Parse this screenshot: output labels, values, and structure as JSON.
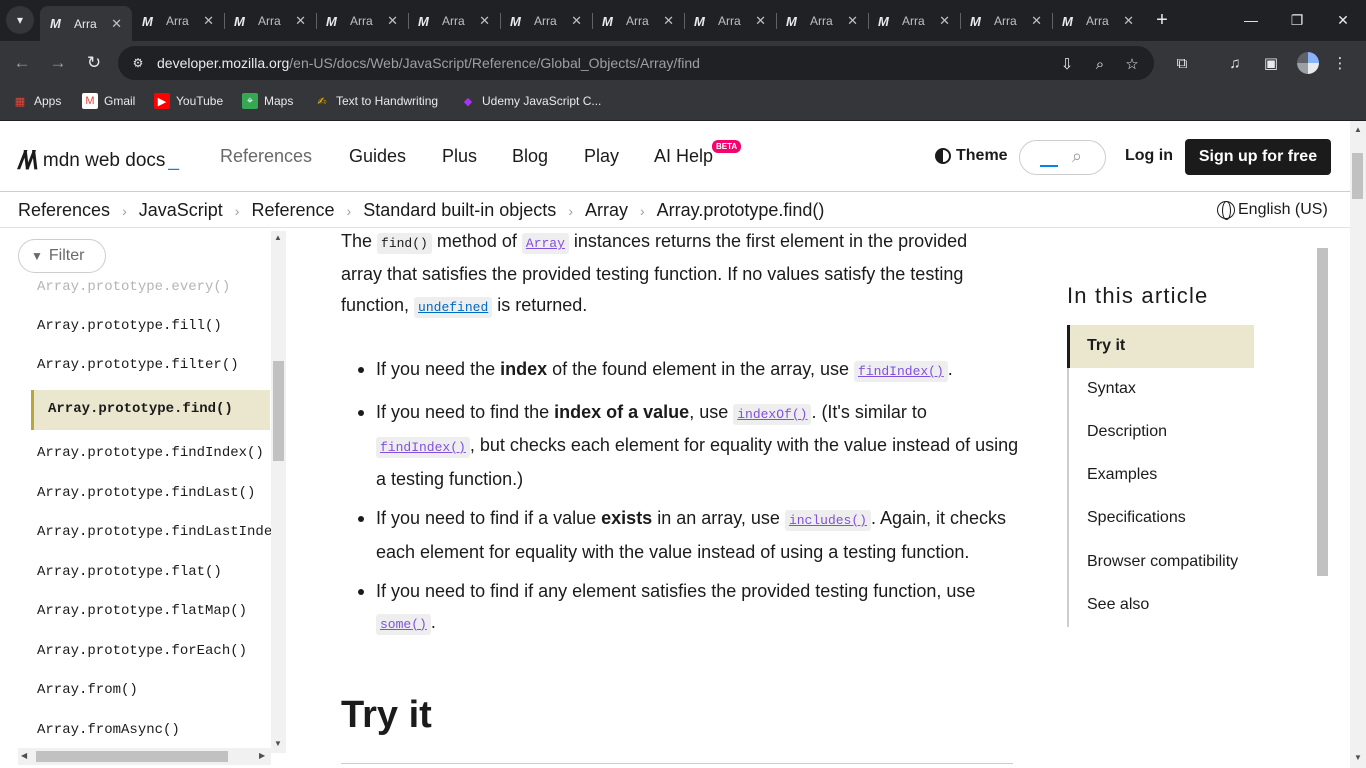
{
  "tabs": [
    {
      "icon": "M",
      "title": "Arra",
      "active": true
    },
    {
      "icon": "M",
      "title": "Arra"
    },
    {
      "icon": "M",
      "title": "Arra"
    },
    {
      "icon": "M",
      "title": "Arra"
    },
    {
      "icon": "M",
      "title": "Arra"
    },
    {
      "icon": "M",
      "title": "Arra"
    },
    {
      "icon": "M",
      "title": "Arra"
    },
    {
      "icon": "M",
      "title": "Arra"
    },
    {
      "icon": "M",
      "title": "Arra"
    },
    {
      "icon": "M",
      "title": "Arra"
    },
    {
      "icon": "M",
      "title": "Arra"
    },
    {
      "icon": "M",
      "title": "Arra"
    }
  ],
  "address": {
    "host": "developer.mozilla.org",
    "path": "/en-US/docs/Web/JavaScript/Reference/Global_Objects/Array/find"
  },
  "bookmarks": [
    {
      "label": "Apps",
      "icon": "apps-grid-icon",
      "color": "#ea4335"
    },
    {
      "label": "Gmail",
      "icon": "gmail-icon",
      "color": "#ea4335"
    },
    {
      "label": "YouTube",
      "icon": "youtube-icon",
      "color": "#ff0000"
    },
    {
      "label": "Maps",
      "icon": "maps-icon",
      "color": "#34a853"
    },
    {
      "label": "Text to Handwriting",
      "icon": "handwriting-icon",
      "color": "#fbbc04"
    },
    {
      "label": "Udemy JavaScript C...",
      "icon": "udemy-icon",
      "color": "#a435f0"
    }
  ],
  "header": {
    "logo_text": "mdn web docs",
    "nav": [
      "References",
      "Guides",
      "Plus",
      "Blog",
      "Play",
      "AI Help"
    ],
    "beta_badge": "BETA",
    "theme_label": "Theme",
    "login_label": "Log in",
    "signup_label": "Sign up for free"
  },
  "breadcrumbs": [
    "References",
    "JavaScript",
    "Reference",
    "Standard built-in objects",
    "Array",
    "Array.prototype.find()"
  ],
  "language": "English (US)",
  "sidebar": {
    "filter_placeholder": "Filter",
    "items": [
      "Array.prototype.every()",
      "Array.prototype.fill()",
      "Array.prototype.filter()",
      "Array.prototype.find()",
      "Array.prototype.findIndex()",
      "Array.prototype.findLast()",
      "Array.prototype.findLastIndex",
      "Array.prototype.flat()",
      "Array.prototype.flatMap()",
      "Array.prototype.forEach()",
      "Array.from()",
      "Array.fromAsync()"
    ],
    "active_item": "Array.prototype.find()"
  },
  "article": {
    "intro": {
      "t1": "The ",
      "c1": "find()",
      "t2": " method of ",
      "c2": "Array",
      "t3": " instances returns the first element in the provided array that satisfies the provided testing function. If no values satisfy the testing function, ",
      "c3": "undefined",
      "t4": " is returned."
    },
    "bullets": [
      {
        "a": "If you need the ",
        "b": "index",
        "c": " of the found element in the array, use ",
        "code": "findIndex()",
        "d": "."
      },
      {
        "a": "If you need to find the ",
        "b": "index of a value",
        "c": ", use ",
        "code": "indexOf()",
        "d": ". (It's similar to ",
        "code2": "findIndex()",
        "e": ", but checks each element for equality with the value instead of using a testing function.)"
      },
      {
        "a": "If you need to find if a value ",
        "b": "exists",
        "c": " in an array, use ",
        "code": "includes()",
        "d": ". Again, it checks each element for equality with the value instead of using a testing function."
      },
      {
        "a": "If you need to find if any element satisfies the provided testing function, use ",
        "code": "some()",
        "d": "."
      }
    ],
    "section_heading": "Try it"
  },
  "toc": {
    "title": "In this article",
    "items": [
      "Try it",
      "Syntax",
      "Description",
      "Examples",
      "Specifications",
      "Browser compatibility",
      "See also"
    ],
    "active": "Try it"
  },
  "colors": {
    "accent_highlight": "#ebe7cf",
    "link_visited": "#8250df",
    "link": "#0069c2",
    "signup_bg": "#1b1b1b",
    "beta_badge": "#f4056d"
  }
}
